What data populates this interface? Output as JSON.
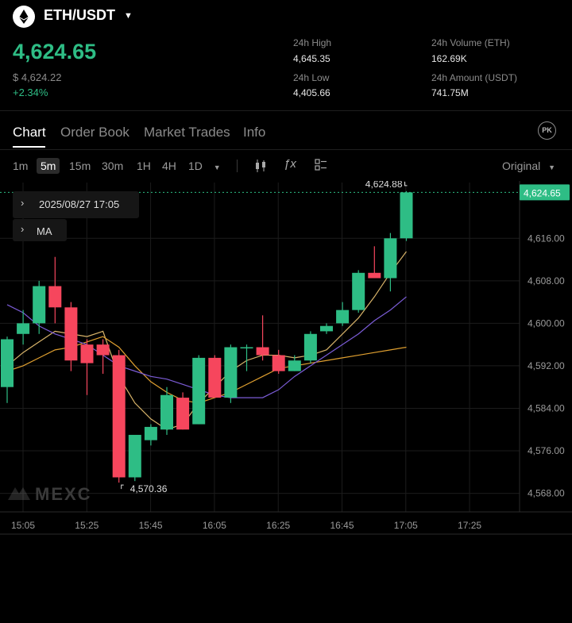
{
  "header": {
    "pair": "ETH/USDT",
    "price": "4,624.65",
    "usd_price": "$ 4,624.22",
    "change": "+2.34%",
    "stats": {
      "high_label": "24h High",
      "high_value": "4,645.35",
      "low_label": "24h Low",
      "low_value": "4,405.66",
      "volume_label": "24h Volume (ETH)",
      "volume_value": "162.69K",
      "amount_label": "24h Amount (USDT)",
      "amount_value": "741.75M"
    }
  },
  "tabs": [
    "Chart",
    "Order Book",
    "Market Trades",
    "Info"
  ],
  "tabs_active": "Chart",
  "pk_label": "PK",
  "timeframes": [
    "1m",
    "5m",
    "15m",
    "30m",
    "1H",
    "4H",
    "1D"
  ],
  "timeframe_active": "5m",
  "chart_mode": "Original",
  "info_rows": {
    "datetime": "2025/08/27 17:05",
    "indicator": "MA"
  },
  "watermark": "MEXC",
  "colors": {
    "up": "#2ebd85",
    "down": "#f6465d",
    "ma_fast": "#d8b46a",
    "ma_mid": "#e0a030",
    "ma_slow": "#7b5cd6"
  },
  "chart_data": {
    "type": "candlestick",
    "x_ticks": [
      "15:05",
      "15:25",
      "15:45",
      "16:05",
      "16:25",
      "16:45",
      "17:05",
      "17:25"
    ],
    "y_ticks": [
      "4,616.00",
      "4,608.00",
      "4,600.00",
      "4,592.00",
      "4,584.00",
      "4,576.00",
      "4,568.00"
    ],
    "ylim": [
      4564.5,
      4626.5
    ],
    "last_price_label": "4,624.65",
    "high_marker": "4,624.88",
    "low_marker": "4,570.36",
    "candles": [
      {
        "o": 4588.0,
        "h": 4597.5,
        "l": 4585.0,
        "c": 4597.0
      },
      {
        "o": 4598.0,
        "h": 4602.5,
        "l": 4596.0,
        "c": 4600.0
      },
      {
        "o": 4600.0,
        "h": 4608.0,
        "l": 4598.0,
        "c": 4607.0
      },
      {
        "o": 4607.0,
        "h": 4612.5,
        "l": 4600.0,
        "c": 4603.0
      },
      {
        "o": 4603.0,
        "h": 4604.0,
        "l": 4591.0,
        "c": 4593.0
      },
      {
        "o": 4596.0,
        "h": 4597.0,
        "l": 4586.5,
        "c": 4592.5
      },
      {
        "o": 4596.0,
        "h": 4597.0,
        "l": 4590.5,
        "c": 4594.0
      },
      {
        "o": 4594.0,
        "h": 4595.0,
        "l": 4570.0,
        "c": 4571.0
      },
      {
        "o": 4571.0,
        "h": 4578.5,
        "l": 4570.3,
        "c": 4579.0
      },
      {
        "o": 4578.0,
        "h": 4581.0,
        "l": 4577.0,
        "c": 4580.5
      },
      {
        "o": 4580.0,
        "h": 4588.0,
        "l": 4579.0,
        "c": 4586.5
      },
      {
        "o": 4586.0,
        "h": 4587.0,
        "l": 4580.0,
        "c": 4580.0
      },
      {
        "o": 4581.0,
        "h": 4594.0,
        "l": 4581.0,
        "c": 4593.5
      },
      {
        "o": 4593.5,
        "h": 4594.0,
        "l": 4586.0,
        "c": 4586.0
      },
      {
        "o": 4586.0,
        "h": 4596.0,
        "l": 4585.0,
        "c": 4595.5
      },
      {
        "o": 4595.5,
        "h": 4596.0,
        "l": 4591.0,
        "c": 4595.5
      },
      {
        "o": 4595.5,
        "h": 4601.5,
        "l": 4593.0,
        "c": 4594.0
      },
      {
        "o": 4594.0,
        "h": 4595.0,
        "l": 4590.5,
        "c": 4591.0
      },
      {
        "o": 4591.0,
        "h": 4594.0,
        "l": 4591.0,
        "c": 4593.0
      },
      {
        "o": 4593.0,
        "h": 4598.5,
        "l": 4592.5,
        "c": 4598.0
      },
      {
        "o": 4598.5,
        "h": 4600.0,
        "l": 4598.0,
        "c": 4599.5
      },
      {
        "o": 4600.0,
        "h": 4604.0,
        "l": 4599.5,
        "c": 4602.5
      },
      {
        "o": 4602.5,
        "h": 4610.0,
        "l": 4602.0,
        "c": 4609.5
      },
      {
        "o": 4609.5,
        "h": 4614.5,
        "l": 4608.5,
        "c": 4608.5
      },
      {
        "o": 4608.5,
        "h": 4617.0,
        "l": 4606.0,
        "c": 4616.0
      },
      {
        "o": 4616.0,
        "h": 4624.88,
        "l": 4615.5,
        "c": 4624.65
      }
    ],
    "ma": [
      {
        "name": "MA5",
        "color": "#d8b46a",
        "values": [
          4592.0,
          4594.5,
          4596.5,
          4598.5,
          4598.0,
          4597.5,
          4598.5,
          4590.0,
          4585.0,
          4582.0,
          4580.0,
          4581.0,
          4585.0,
          4588.0,
          4591.0,
          4593.0,
          4594.0,
          4594.0,
          4593.5,
          4594.0,
          4595.0,
          4598.0,
          4601.0,
          4605.0,
          4609.5,
          4613.5
        ]
      },
      {
        "name": "MA10",
        "color": "#e0a030",
        "values": [
          4591.0,
          4592.0,
          4593.5,
          4595.0,
          4595.5,
          4596.5,
          4597.5,
          4595.5,
          4592.0,
          4589.0,
          4587.0,
          4585.5,
          4585.0,
          4586.0,
          4587.0,
          4588.5,
          4590.0,
          4591.5,
          4592.0,
          4592.5,
          4593.0,
          4593.5,
          4594.0,
          4594.5,
          4595.0,
          4595.5
        ]
      },
      {
        "name": "MA30",
        "color": "#7b5cd6",
        "values": [
          4603.5,
          4602.0,
          4599.5,
          4598.0,
          4597.0,
          4596.0,
          4594.0,
          4592.0,
          4591.0,
          4590.0,
          4589.5,
          4588.5,
          4587.5,
          4586.5,
          4586.0,
          4586.0,
          4586.0,
          4587.5,
          4590.0,
          4592.0,
          4594.0,
          4596.0,
          4598.0,
          4600.5,
          4602.5,
          4605.0
        ]
      }
    ]
  }
}
